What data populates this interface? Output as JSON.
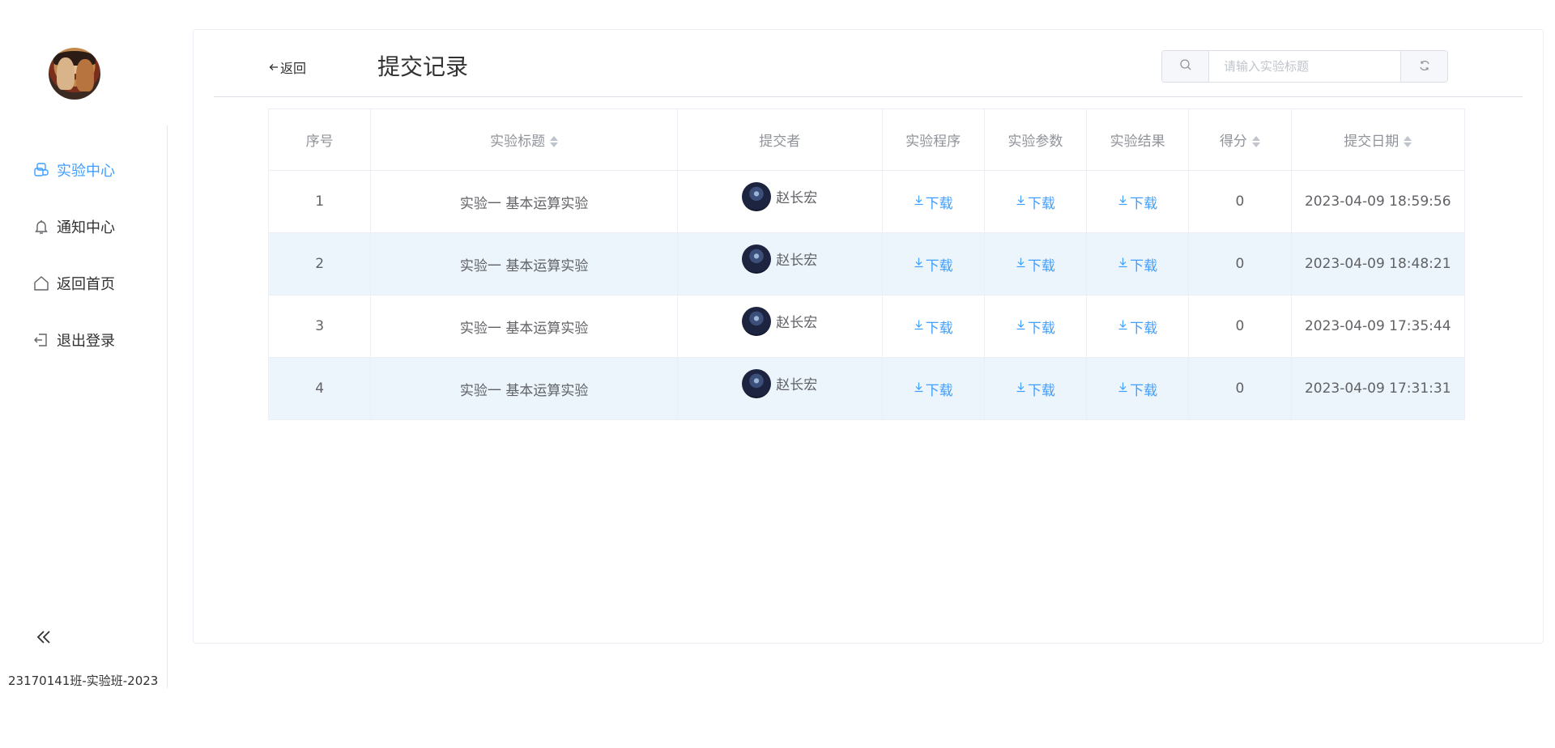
{
  "sidebar": {
    "items": [
      {
        "label": "实验中心",
        "icon": "lab-icon",
        "active": true
      },
      {
        "label": "通知中心",
        "icon": "bell-icon",
        "active": false
      },
      {
        "label": "返回首页",
        "icon": "home-icon",
        "active": false
      },
      {
        "label": "退出登录",
        "icon": "logout-icon",
        "active": false
      }
    ],
    "collapse_icon": "double-chevron-left-icon",
    "class_label": "23170141班-实验班-2023"
  },
  "header": {
    "back_label": "返回",
    "title": "提交记录",
    "search": {
      "placeholder": "请输入实验标题",
      "value": ""
    }
  },
  "table": {
    "columns": [
      "序号",
      "实验标题",
      "提交者",
      "实验程序",
      "实验参数",
      "实验结果",
      "得分",
      "提交日期"
    ],
    "sortable": [
      "实验标题",
      "得分",
      "提交日期"
    ],
    "download_label": "下载",
    "rows": [
      {
        "index": "1",
        "title": "实验一 基本运算实验",
        "submitter": "赵长宏",
        "score": "0",
        "date": "2023-04-09 18:59:56"
      },
      {
        "index": "2",
        "title": "实验一 基本运算实验",
        "submitter": "赵长宏",
        "score": "0",
        "date": "2023-04-09 18:48:21"
      },
      {
        "index": "3",
        "title": "实验一 基本运算实验",
        "submitter": "赵长宏",
        "score": "0",
        "date": "2023-04-09 17:35:44"
      },
      {
        "index": "4",
        "title": "实验一 基本运算实验",
        "submitter": "赵长宏",
        "score": "0",
        "date": "2023-04-09 17:31:31"
      }
    ]
  },
  "colors": {
    "accent": "#409eff",
    "stripe": "#ecf5fc",
    "border": "#ebeef5"
  }
}
